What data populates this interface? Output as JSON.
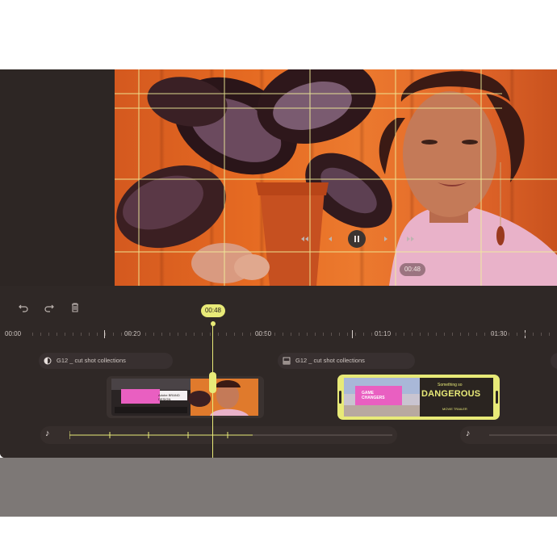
{
  "preview": {
    "timestamp": "00:48"
  },
  "toolbar": {
    "undo_icon": "undo-icon",
    "redo_icon": "redo-icon",
    "delete_icon": "trash-icon",
    "playback_icons": [
      "rewind-icon",
      "step-back-icon",
      "pause-icon",
      "step-forward-icon",
      "fast-forward-icon"
    ]
  },
  "playhead": {
    "time": "00:48"
  },
  "ruler": {
    "labels": [
      "00:00",
      "00:20",
      "00:50",
      "01:10",
      "01:30"
    ]
  },
  "tracks": [
    {
      "label": "G12 _ cut shot collections",
      "icon": "contrast-icon"
    },
    {
      "label": "G12 _ cut shot collections",
      "icon": "gradient-icon"
    }
  ],
  "clips": {
    "clip1_text": [
      "Adobe",
      "BRAND",
      "DESIGN"
    ],
    "clip2_text": {
      "billboard": "GAME CHANGERS",
      "headline": "DANGEROUS",
      "kicker": "Something so",
      "footer": "MOVIE TRAILER"
    }
  },
  "colors": {
    "accent": "#e8ea78",
    "background": "#2f2826",
    "preview_orange": "#e56a22"
  },
  "audio": {
    "note_icon": "music-note-icon"
  }
}
